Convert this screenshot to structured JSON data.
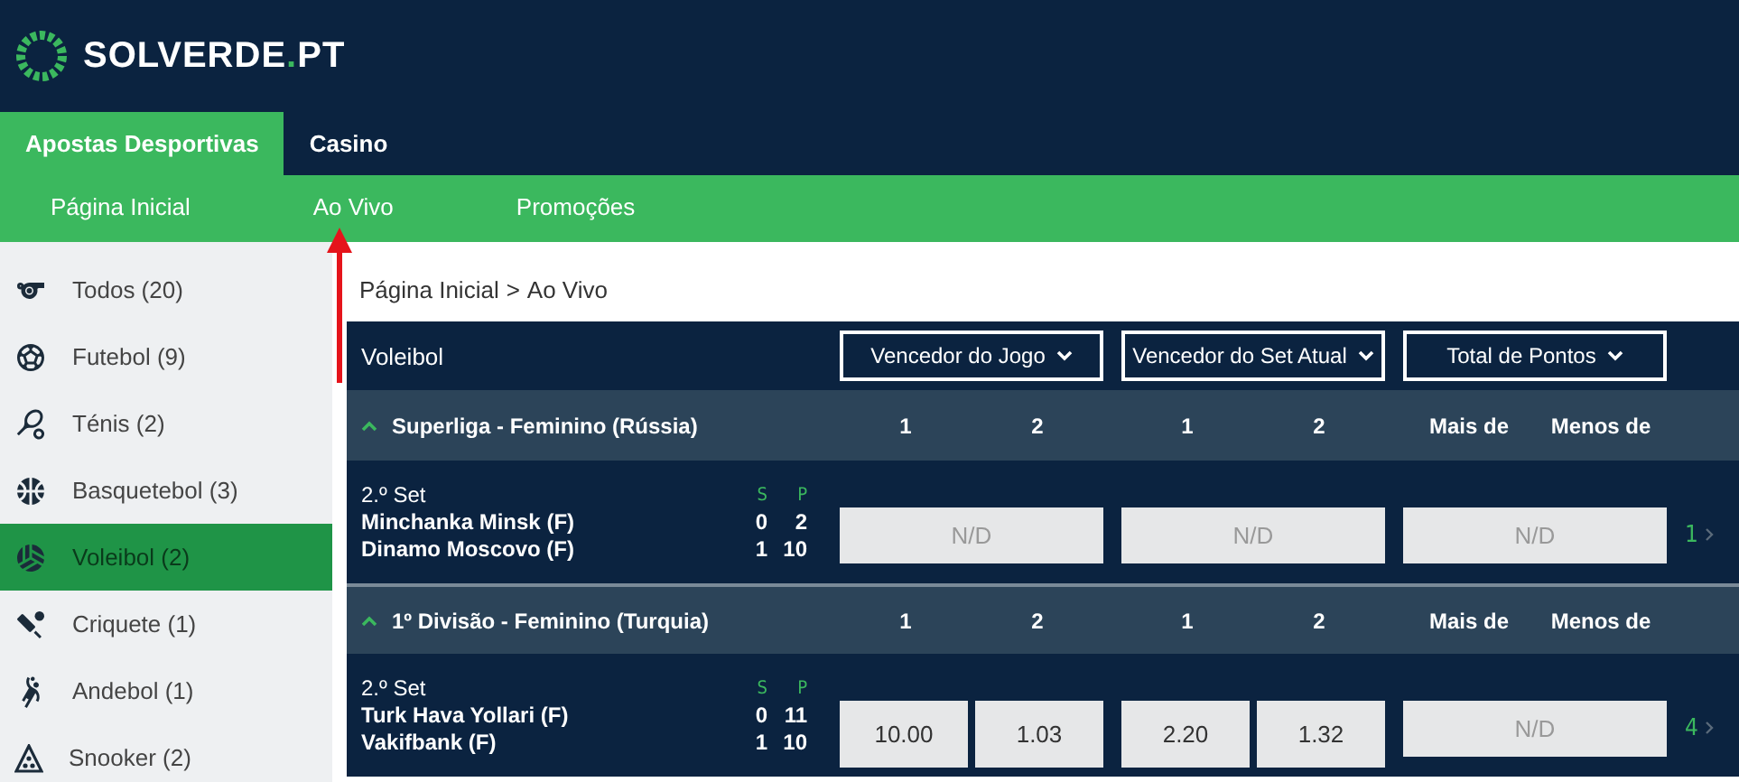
{
  "logo": {
    "name": "SOLVERDE",
    "dot": ".",
    "suffix": "PT"
  },
  "top_tabs": [
    {
      "label": "Apostas Desportivas",
      "selected": true
    },
    {
      "label": "Casino",
      "selected": false
    }
  ],
  "sub_nav": [
    {
      "label": "Página Inicial"
    },
    {
      "label": "Ao Vivo"
    },
    {
      "label": "Promoções"
    }
  ],
  "sidebar": {
    "items": [
      {
        "label": "Todos (20)",
        "kind": "all",
        "selected": false
      },
      {
        "label": "Futebol (9)",
        "kind": "football",
        "selected": false
      },
      {
        "label": "Ténis (2)",
        "kind": "tennis",
        "selected": false
      },
      {
        "label": "Basquetebol (3)",
        "kind": "basketball",
        "selected": false
      },
      {
        "label": "Voleibol (2)",
        "kind": "volleyball",
        "selected": true
      },
      {
        "label": "Criquete (1)",
        "kind": "cricket",
        "selected": false
      },
      {
        "label": "Andebol (1)",
        "kind": "handball",
        "selected": false
      },
      {
        "label": "Snooker (2)",
        "kind": "snooker",
        "selected": false
      }
    ]
  },
  "breadcrumb": [
    "Página Inicial",
    "Ao Vivo"
  ],
  "breadcrumb_separator": ">",
  "table": {
    "sport": "Voleibol",
    "markets": [
      "Vencedor do Jogo",
      "Vencedor do Set Atual",
      "Total de Pontos"
    ],
    "leagues": [
      {
        "name": "Superliga - Feminino (Rússia)",
        "expanded": true,
        "headers": [
          [
            "1",
            "2"
          ],
          [
            "1",
            "2"
          ],
          [
            "Mais de",
            "Menos de"
          ]
        ],
        "event": {
          "period": "2.º Set",
          "score_labels": [
            "S",
            "P"
          ],
          "teams": [
            {
              "name": "Minchanka Minsk (F)",
              "sets": "0",
              "points": "2"
            },
            {
              "name": "Dinamo Moscovo (F)",
              "sets": "1",
              "points": "10"
            }
          ],
          "odds": [
            [
              "N/D"
            ],
            [
              "N/D"
            ],
            [
              "N/D"
            ]
          ],
          "more_markets": "1"
        }
      },
      {
        "name": "1º Divisão - Feminino (Turquia)",
        "expanded": true,
        "headers": [
          [
            "1",
            "2"
          ],
          [
            "1",
            "2"
          ],
          [
            "Mais de",
            "Menos de"
          ]
        ],
        "event": {
          "period": "2.º Set",
          "score_labels": [
            "S",
            "P"
          ],
          "teams": [
            {
              "name": "Turk Hava Yollari (F)",
              "sets": "0",
              "points": "11"
            },
            {
              "name": "Vakifbank (F)",
              "sets": "1",
              "points": "10"
            }
          ],
          "odds": [
            [
              "10.00",
              "1.03"
            ],
            [
              "2.20",
              "1.32"
            ],
            [
              "N/D"
            ]
          ],
          "more_markets": "4"
        }
      }
    ]
  }
}
